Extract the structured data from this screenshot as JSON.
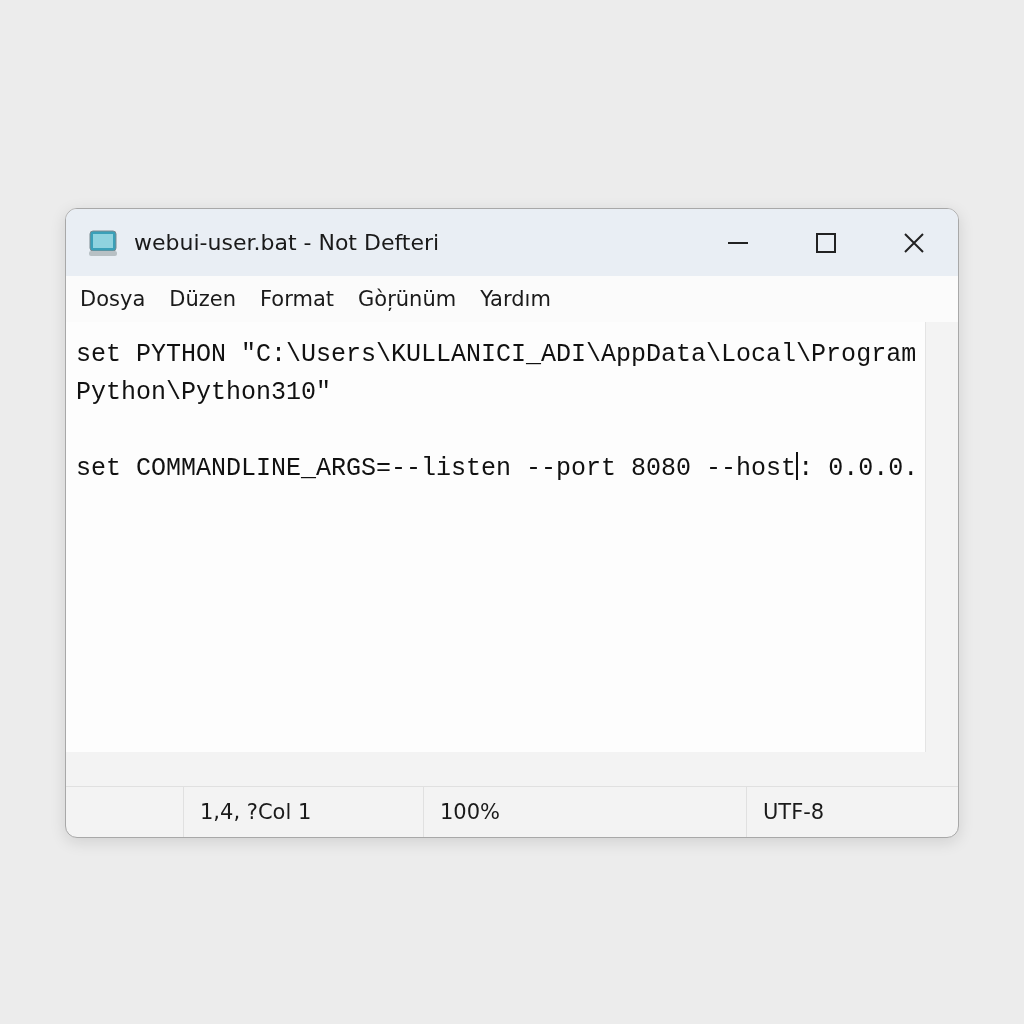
{
  "window": {
    "title": "webui-user.bat - Not Defteri"
  },
  "menu": [
    "Dosya",
    "Düzen",
    "Format",
    "Gòŗünüm",
    "Yardım"
  ],
  "editor": {
    "lines": [
      {
        "kind": "text",
        "text": "set PYTHON \"C:\\Users\\KULLANICI_ADI\\AppData\\Local\\Program"
      },
      {
        "kind": "text",
        "text": "Python\\Python310\""
      },
      {
        "kind": "blank"
      },
      {
        "kind": "text",
        "text": "set COMMANDLINE_ARGS=--listen --port 8080 --host",
        "after_caret": ": 0.0.0."
      }
    ]
  },
  "status_bar": [
    "1,4, ?Col 1",
    "100%",
    "UTF-8"
  ]
}
